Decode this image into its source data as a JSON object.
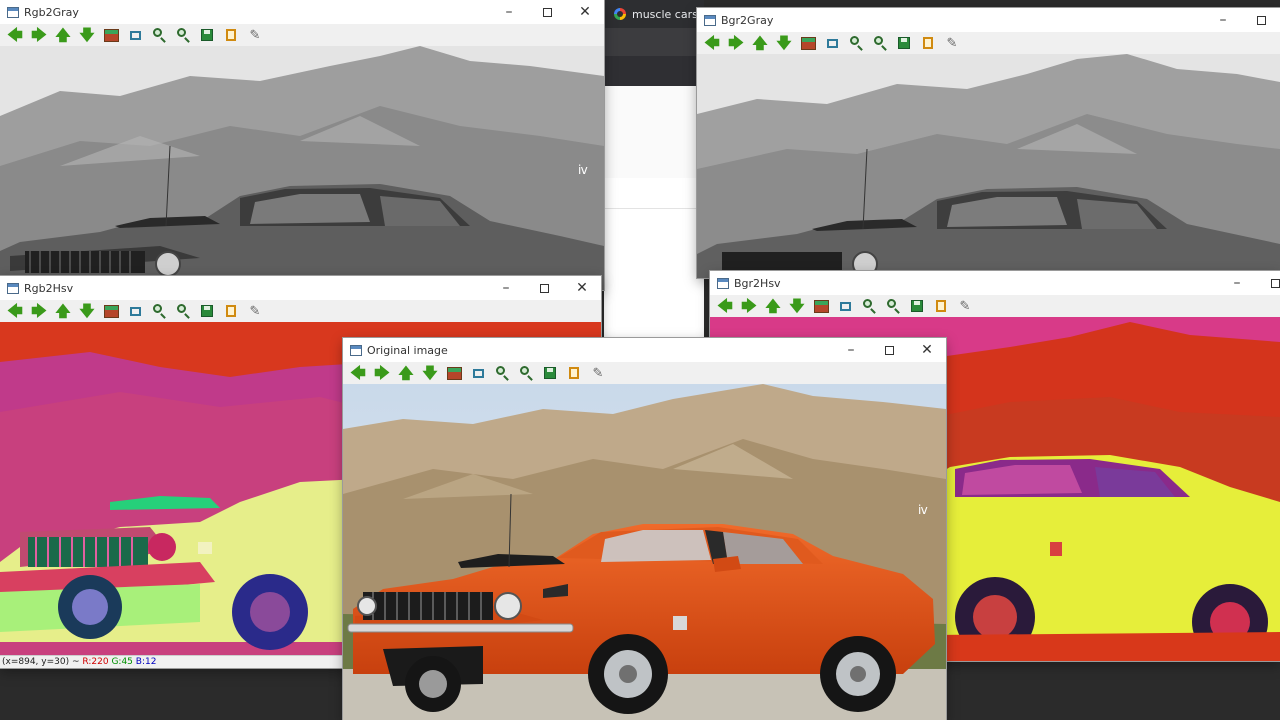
{
  "browser": {
    "tab_title": "muscle cars sm"
  },
  "icons": [
    "arrow-left-icon",
    "arrow-right-icon",
    "arrow-up-icon",
    "arrow-down-icon",
    "image-icon",
    "select-region-icon",
    "zoom-in-icon",
    "zoom-out-icon",
    "save-icon",
    "copy-icon",
    "properties-icon"
  ],
  "windows": {
    "rgb2gray": {
      "title": "Rgb2Gray"
    },
    "bgr2gray": {
      "title": "Bgr2Gray"
    },
    "rgb2hsv": {
      "title": "Rgb2Hsv",
      "status": {
        "coords": "(x=894, y=30) ~",
        "r": "R:220",
        "g": "G:45",
        "b": "B:12"
      }
    },
    "bgr2hsv": {
      "title": "Bgr2Hsv"
    },
    "original": {
      "title": "Original image"
    }
  },
  "colors": {
    "car_orange": "#e8561c",
    "hsv_magenta": "#d0407a",
    "hsv_red": "#d0301a",
    "hsv_yellow": "#e8f040",
    "gray_sky": "#e6e6e6"
  }
}
